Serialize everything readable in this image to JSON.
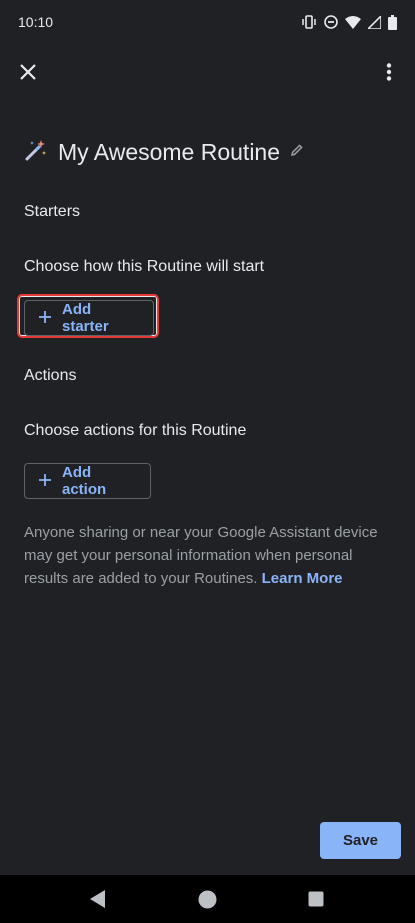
{
  "status_bar": {
    "time": "10:10",
    "icons": [
      "vibrate-icon",
      "do-not-disturb-icon",
      "wifi-icon",
      "signal-icon",
      "battery-icon"
    ]
  },
  "top_bar": {
    "close_icon": "close-icon",
    "more_icon": "more-vert-icon"
  },
  "routine": {
    "title": "My Awesome Routine",
    "title_icon": "magic-wand-icon",
    "edit_icon": "pencil-icon"
  },
  "starters": {
    "heading": "Starters",
    "description": "Choose how this Routine will start",
    "button_label": "Add starter"
  },
  "actions": {
    "heading": "Actions",
    "description": "Choose actions for this Routine",
    "button_label": "Add action"
  },
  "disclaimer": {
    "text": "Anyone sharing or near your Google Assistant device may get your personal information when personal results are added to your Routines. ",
    "link": "Learn More"
  },
  "footer": {
    "save_label": "Save"
  },
  "colors": {
    "background": "#202124",
    "accent": "#8ab4f8",
    "highlight": "#e53935"
  }
}
